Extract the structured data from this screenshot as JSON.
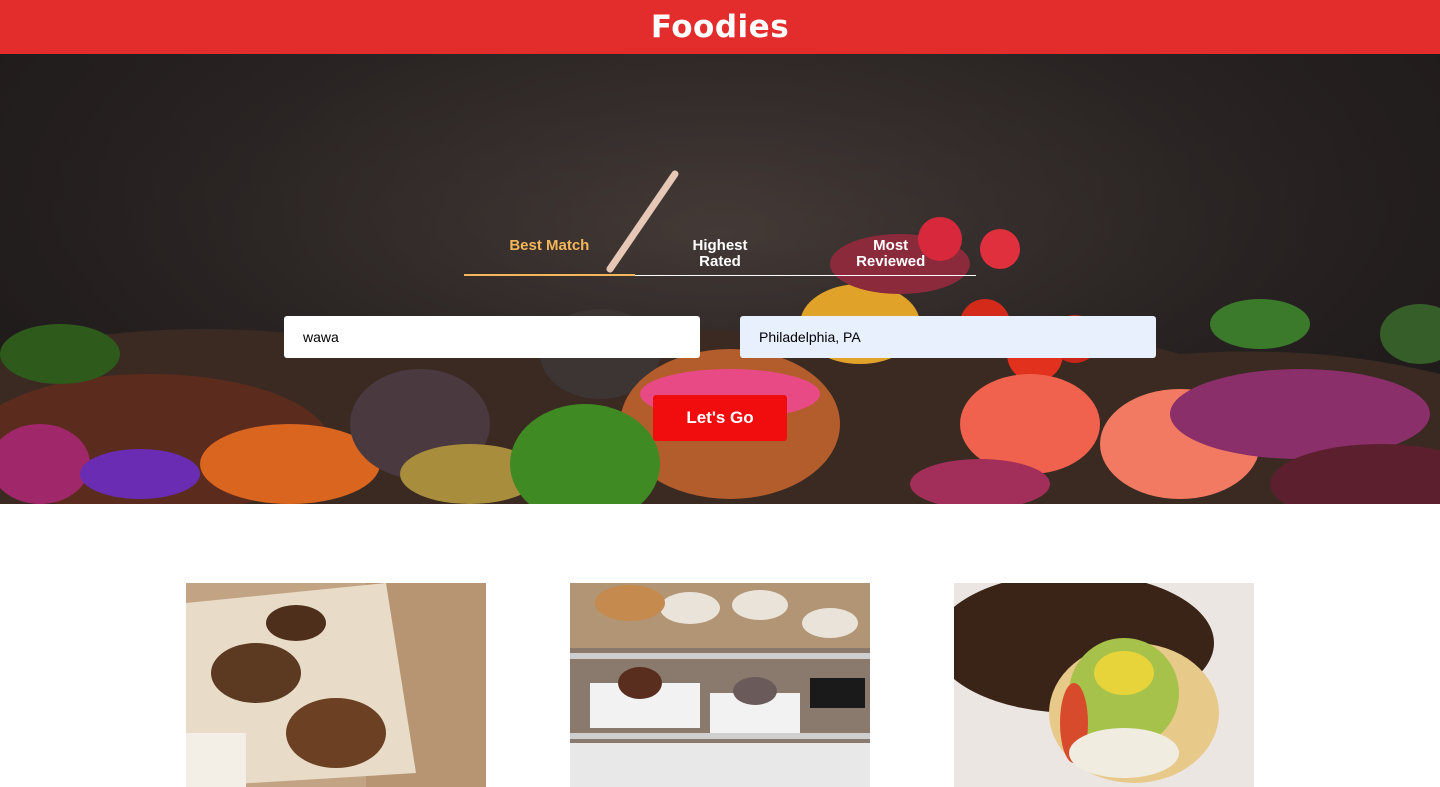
{
  "header": {
    "title": "Foodies"
  },
  "sort_tabs": [
    {
      "label": "Best Match",
      "active": true
    },
    {
      "label": "Highest Rated",
      "active": false
    },
    {
      "label": "Most Reviewed",
      "active": false
    }
  ],
  "search": {
    "term_value": "wawa",
    "location_value": "Philadelphia, PA",
    "submit_label": "Let's Go"
  },
  "colors": {
    "header": "#e32d2d",
    "active_tab": "#f4b65a",
    "button": "#f10d0d",
    "location_autofill": "#e8f0fe"
  },
  "results": [
    {
      "image": "flatbread-photo"
    },
    {
      "image": "bakery-case-photo"
    },
    {
      "image": "hoagie-photo"
    }
  ]
}
